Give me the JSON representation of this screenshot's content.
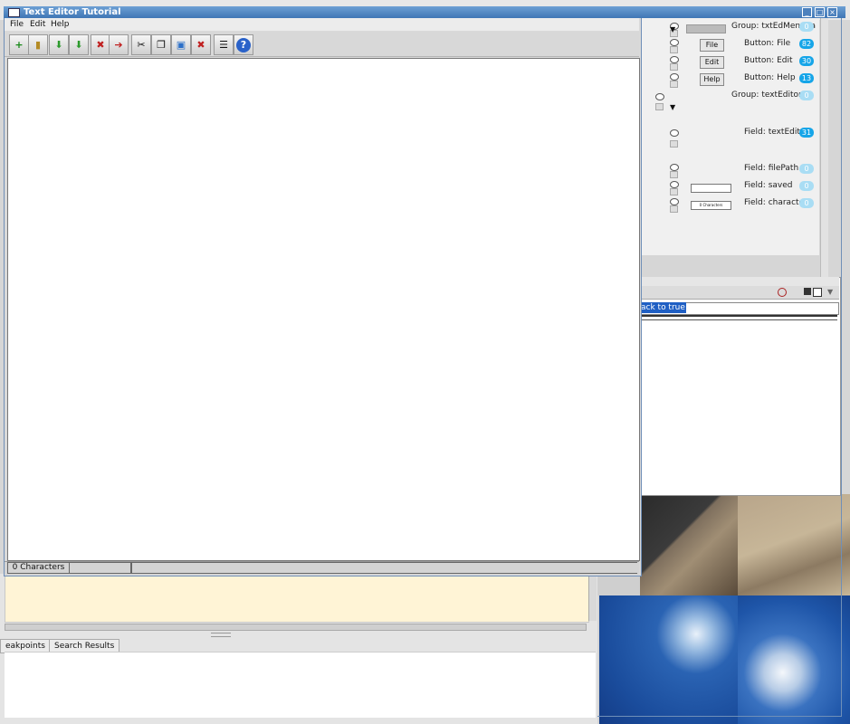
{
  "window": {
    "title": "Text Editor Tutorial"
  },
  "menu": [
    "File",
    "Edit",
    "Help"
  ],
  "toolbar_icons": [
    "new-icon",
    "open-icon",
    "save-icon",
    "save-as-icon",
    "close-icon",
    "exit-icon",
    "cut-icon",
    "copy-icon",
    "paste-icon",
    "delete-icon",
    "preferences-icon",
    "help-icon"
  ],
  "status": {
    "characters": "0 Characters",
    "cell2": "",
    "cell3": ""
  },
  "layers": {
    "group1": {
      "type": "Group:",
      "name": "txtEdMenuba",
      "count": "0"
    },
    "file": {
      "type": "Button:",
      "name": "File",
      "count": "82",
      "btn": "File"
    },
    "edit": {
      "type": "Button:",
      "name": "Edit",
      "count": "30",
      "btn": "Edit"
    },
    "help": {
      "type": "Button:",
      "name": "Help",
      "count": "13",
      "btn": "Help"
    },
    "group2": {
      "type": "Group:",
      "name": "textEditor",
      "count": "0"
    },
    "texteditor": {
      "type": "Field:",
      "name": "textEditor",
      "count": "31"
    },
    "filepath": {
      "type": "Field:",
      "name": "filePath",
      "count": "0"
    },
    "saved": {
      "type": "Field:",
      "name": "saved",
      "count": "0"
    },
    "characters": {
      "type": "Field:",
      "name": "character",
      "count": "0",
      "preview": "0 Characters"
    }
  },
  "console": {
    "selected_text": "ack to true"
  },
  "ide": {
    "tab1": "eakpoints",
    "tab2": "Search Results"
  }
}
